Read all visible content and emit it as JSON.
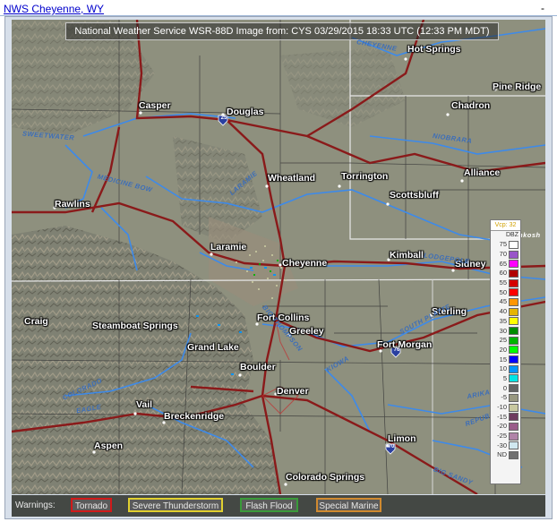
{
  "page": {
    "title_link": "NWS Cheyenne, WY",
    "minimize": "-"
  },
  "map": {
    "header": "National Weather Service WSR-88D Image  from: CYS  03/29/2015  18:33 UTC  (12:33 PM MDT)",
    "cities": [
      {
        "name": "Hot Springs"
      },
      {
        "name": "Pine Ridge"
      },
      {
        "name": "Casper"
      },
      {
        "name": "Douglas"
      },
      {
        "name": "Chadron"
      },
      {
        "name": "Wheatland"
      },
      {
        "name": "Torrington"
      },
      {
        "name": "Alliance"
      },
      {
        "name": "Scottsbluff"
      },
      {
        "name": "Rawlins"
      },
      {
        "name": "Laramie"
      },
      {
        "name": "Cheyenne"
      },
      {
        "name": "Kimball"
      },
      {
        "name": "Sidney"
      },
      {
        "name": "Sterling"
      },
      {
        "name": "Fort Collins"
      },
      {
        "name": "Craig"
      },
      {
        "name": "Steamboat Springs"
      },
      {
        "name": "Greeley"
      },
      {
        "name": "Grand Lake"
      },
      {
        "name": "Fort Morgan"
      },
      {
        "name": "Boulder"
      },
      {
        "name": "Denver"
      },
      {
        "name": "Vail"
      },
      {
        "name": "Breckenridge"
      },
      {
        "name": "Aspen"
      },
      {
        "name": "Limon"
      },
      {
        "name": "Colorado Springs"
      }
    ],
    "rivers": [
      {
        "name": "CHEYENNE"
      },
      {
        "name": "NIOBRARA"
      },
      {
        "name": "SWEETWATER"
      },
      {
        "name": "MEDICINE BOW"
      },
      {
        "name": "LARAMIE"
      },
      {
        "name": "LODGEPOLE"
      },
      {
        "name": "SOUTH PLATTE"
      },
      {
        "name": "BIG THOMPSON"
      },
      {
        "name": "KIOWA"
      },
      {
        "name": "COLORADO"
      },
      {
        "name": "EAGLE"
      },
      {
        "name": "ARIKAREE"
      },
      {
        "name": "REPUBLICAN"
      },
      {
        "name": "BIG SANDY"
      },
      {
        "name": "Oshkosh"
      }
    ],
    "highways": [
      "25",
      "76",
      "70"
    ]
  },
  "legend": {
    "vcp": "Vcp: 32",
    "unit": "DBZ",
    "rows": [
      {
        "value": "75",
        "color": "#ffffff"
      },
      {
        "value": "70",
        "color": "#9955c9"
      },
      {
        "value": "65",
        "color": "#ff00ff"
      },
      {
        "value": "60",
        "color": "#b00000"
      },
      {
        "value": "55",
        "color": "#d40000"
      },
      {
        "value": "50",
        "color": "#ff0000"
      },
      {
        "value": "45",
        "color": "#ff9600"
      },
      {
        "value": "40",
        "color": "#e6b400"
      },
      {
        "value": "35",
        "color": "#ffff00"
      },
      {
        "value": "30",
        "color": "#008c00"
      },
      {
        "value": "25",
        "color": "#00b400"
      },
      {
        "value": "20",
        "color": "#00ff00"
      },
      {
        "value": "15",
        "color": "#0000ff"
      },
      {
        "value": "10",
        "color": "#0096ff"
      },
      {
        "value": "5",
        "color": "#00e6e6"
      },
      {
        "value": "0",
        "color": "#646464"
      },
      {
        "value": "-5",
        "color": "#989880"
      },
      {
        "value": "-10",
        "color": "#c8c8a0"
      },
      {
        "value": "-15",
        "color": "#6e3a5e"
      },
      {
        "value": "-20",
        "color": "#9a5c8a"
      },
      {
        "value": "-25",
        "color": "#b084a8"
      },
      {
        "value": "-30",
        "color": "#d0e8f0"
      },
      {
        "value": "ND",
        "color": "#707070"
      }
    ]
  },
  "warnings": {
    "label": "Warnings:",
    "buttons": [
      {
        "label": "Tornado",
        "border": "#d01a1a"
      },
      {
        "label": "Severe Thunderstorm",
        "border": "#e0d030"
      },
      {
        "label": "Flash Flood",
        "border": "#3a9a3a"
      },
      {
        "label": "Special Marine",
        "border": "#d08a30"
      }
    ]
  }
}
